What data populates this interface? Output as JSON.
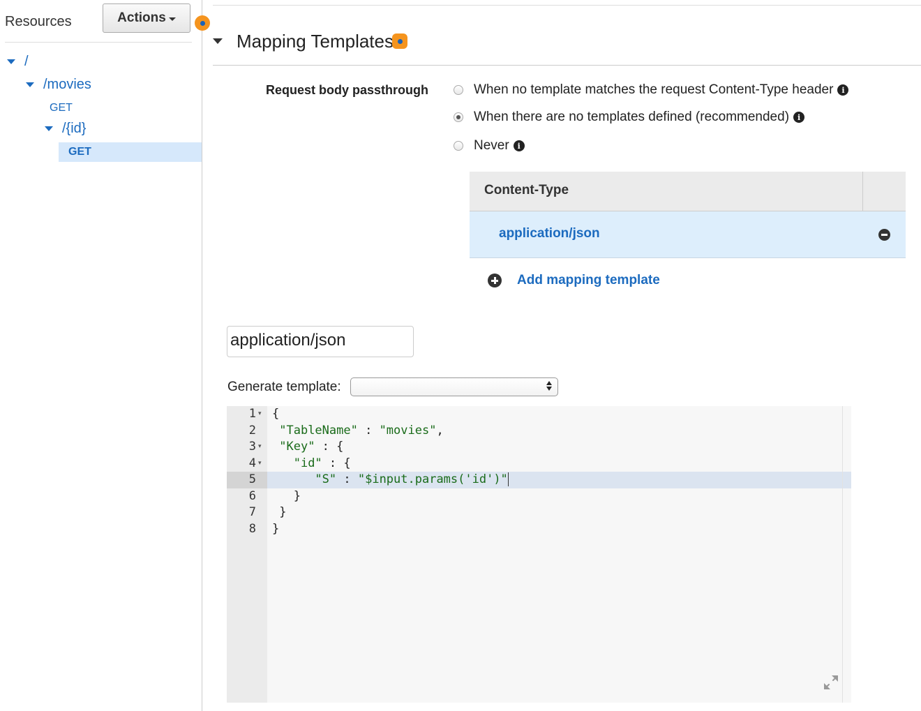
{
  "sidebar": {
    "title": "Resources",
    "actions_label": "Actions",
    "tree": {
      "root": "/",
      "movies": "/movies",
      "movies_method": "GET",
      "id": "/{id}",
      "id_method": "GET"
    }
  },
  "mapping_templates": {
    "title": "Mapping Templates",
    "passthrough_label": "Request body passthrough",
    "options": [
      {
        "label": "When no template matches the request Content-Type header",
        "checked": false
      },
      {
        "label": "When there are no templates defined (recommended)",
        "checked": true
      },
      {
        "label": "Never",
        "checked": false
      }
    ],
    "table_header": "Content-Type",
    "content_types": [
      "application/json"
    ],
    "add_label": "Add mapping template"
  },
  "template_editor": {
    "content_type_value": "application/json",
    "generate_label": "Generate template:",
    "generate_selected": "",
    "line_numbers": [
      "1",
      "2",
      "3",
      "4",
      "5",
      "6",
      "7",
      "8"
    ],
    "active_line": 5
  },
  "colors": {
    "link_blue": "#1c6bbf",
    "selected_bg": "#d6e8fb",
    "badge_orange": "#f5941e",
    "string_green": "#1a6b1a"
  }
}
